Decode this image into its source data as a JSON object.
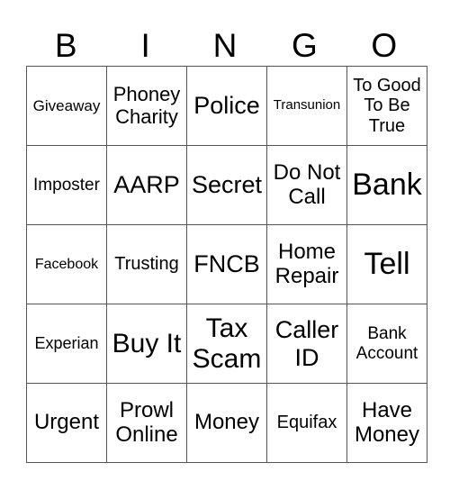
{
  "header": [
    "B",
    "I",
    "N",
    "G",
    "O"
  ],
  "rows": [
    [
      "Giveaway",
      "Phoney Charity",
      "Police",
      "Transunion",
      "To Good To Be True"
    ],
    [
      "Imposter",
      "AARP",
      "Secret",
      "Do Not Call",
      "Bank"
    ],
    [
      "Facebook",
      "Trusting",
      "FNCB",
      "Home Repair",
      "Tell"
    ],
    [
      "Experian",
      "Buy It",
      "Tax Scam",
      "Caller ID",
      "Bank Account"
    ],
    [
      "Urgent",
      "Prowl Online",
      "Money",
      "Equifax",
      "Have Money"
    ]
  ]
}
